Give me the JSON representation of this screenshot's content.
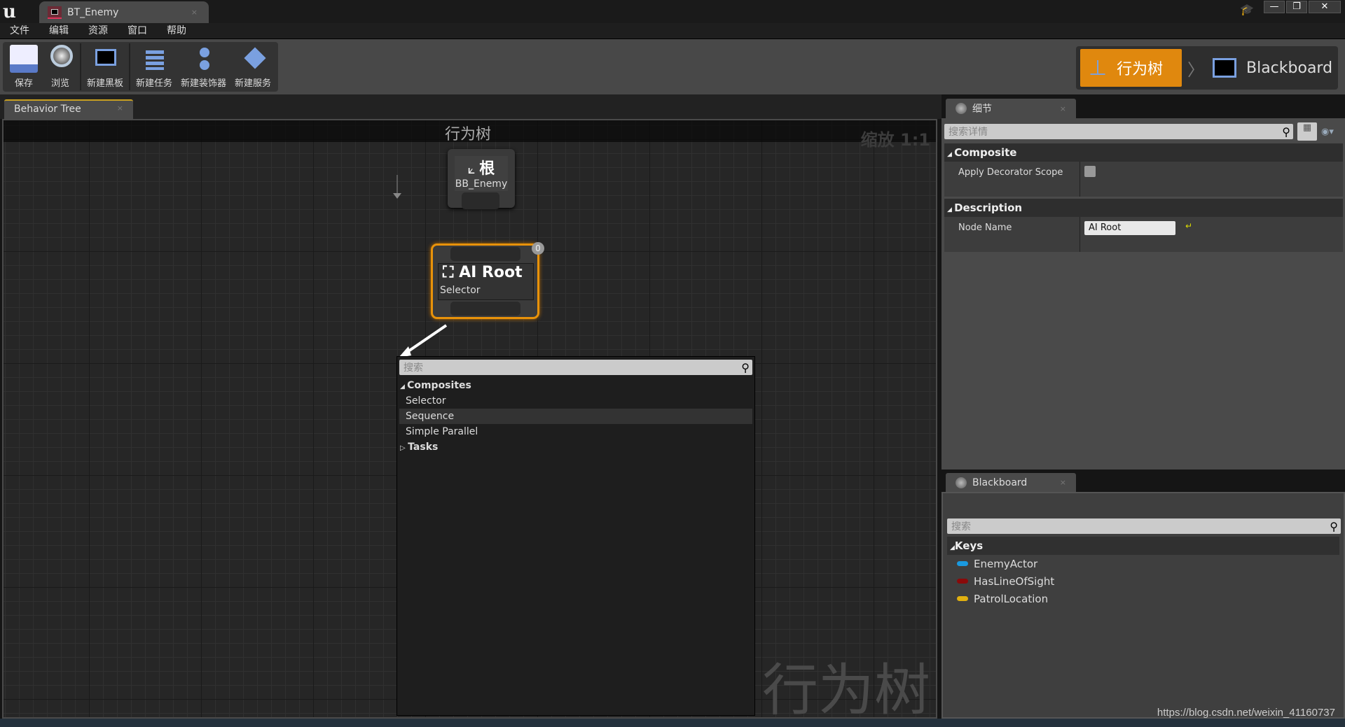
{
  "window": {
    "tab_title": "BT_Enemy",
    "close": "×",
    "minimize": "—",
    "restore": "❐",
    "close_window": "✕"
  },
  "menu": [
    "文件",
    "编辑",
    "资源",
    "窗口",
    "帮助"
  ],
  "toolbar": {
    "save": "保存",
    "browse": "浏览",
    "new_blackboard": "新建黑板",
    "new_task": "新建任务",
    "new_decorator": "新建装饰器",
    "new_service": "新建服务"
  },
  "modes": {
    "behavior_tree": "行为树",
    "blackboard": "Blackboard",
    "separator": "〉"
  },
  "graph": {
    "tab": "Behavior Tree",
    "tab_close": "×",
    "title": "行为树",
    "zoom": "缩放 1:1",
    "watermark": "行为树",
    "root_node": {
      "title": "根",
      "subtitle": "BB_Enemy"
    },
    "ai_node": {
      "title": "AI Root",
      "subtitle": "Selector",
      "badge": "0"
    }
  },
  "context_menu": {
    "search_placeholder": "搜索",
    "categories": [
      {
        "label": "Composites",
        "expanded": true,
        "items": [
          "Selector",
          "Sequence",
          "Simple Parallel"
        ],
        "highlighted": "Sequence"
      },
      {
        "label": "Tasks",
        "expanded": false
      }
    ]
  },
  "details": {
    "tab": "细节",
    "tab_close": "×",
    "search_placeholder": "搜索详情",
    "sections": [
      {
        "label": "Composite",
        "props": [
          {
            "name": "Apply Decorator Scope",
            "checked": false
          }
        ]
      },
      {
        "label": "Description",
        "props": [
          {
            "name": "Node Name",
            "value": "AI Root"
          }
        ]
      }
    ]
  },
  "blackboard": {
    "tab": "Blackboard",
    "tab_close": "×",
    "search_placeholder": "搜索",
    "keys_label": "Keys",
    "keys": [
      {
        "name": "EnemyActor",
        "color": "#1a9ae0"
      },
      {
        "name": "HasLineOfSight",
        "color": "#8a0a0a"
      },
      {
        "name": "PatrolLocation",
        "color": "#e0b010"
      }
    ]
  },
  "footer": {
    "url": "https://blog.csdn.net/weixin_41160737"
  },
  "colors": {
    "accent": "#e0880e",
    "selected_node_border": "#e8920a"
  }
}
